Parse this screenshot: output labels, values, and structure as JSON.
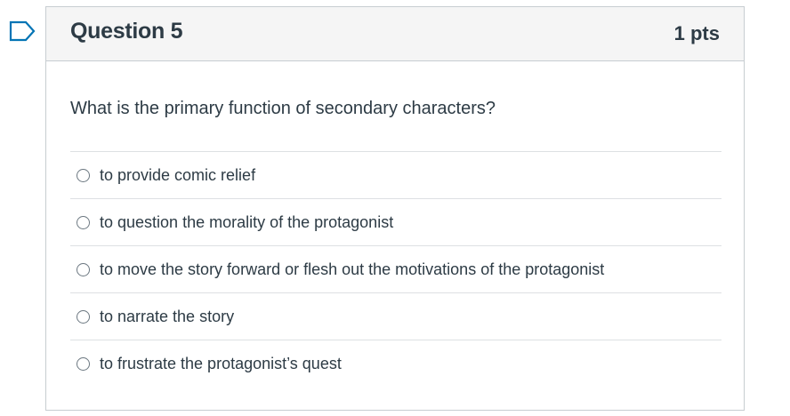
{
  "question": {
    "title": "Question 5",
    "points": "1 pts",
    "text": "What is the primary function of secondary characters?",
    "flag_icon": "flag-outline-icon",
    "answers": [
      {
        "label": "to provide comic relief",
        "selected": false
      },
      {
        "label": "to question the morality of the protagonist",
        "selected": false
      },
      {
        "label": "to move the story forward or flesh out the motivations of the protagonist",
        "selected": false
      },
      {
        "label": "to narrate the story",
        "selected": false
      },
      {
        "label": "to frustrate the protagonist’s quest",
        "selected": false
      }
    ]
  },
  "colors": {
    "accent": "#0374b5",
    "text": "#2d3b45",
    "header_bg": "#f5f5f5",
    "border": "#c7cdd1"
  }
}
